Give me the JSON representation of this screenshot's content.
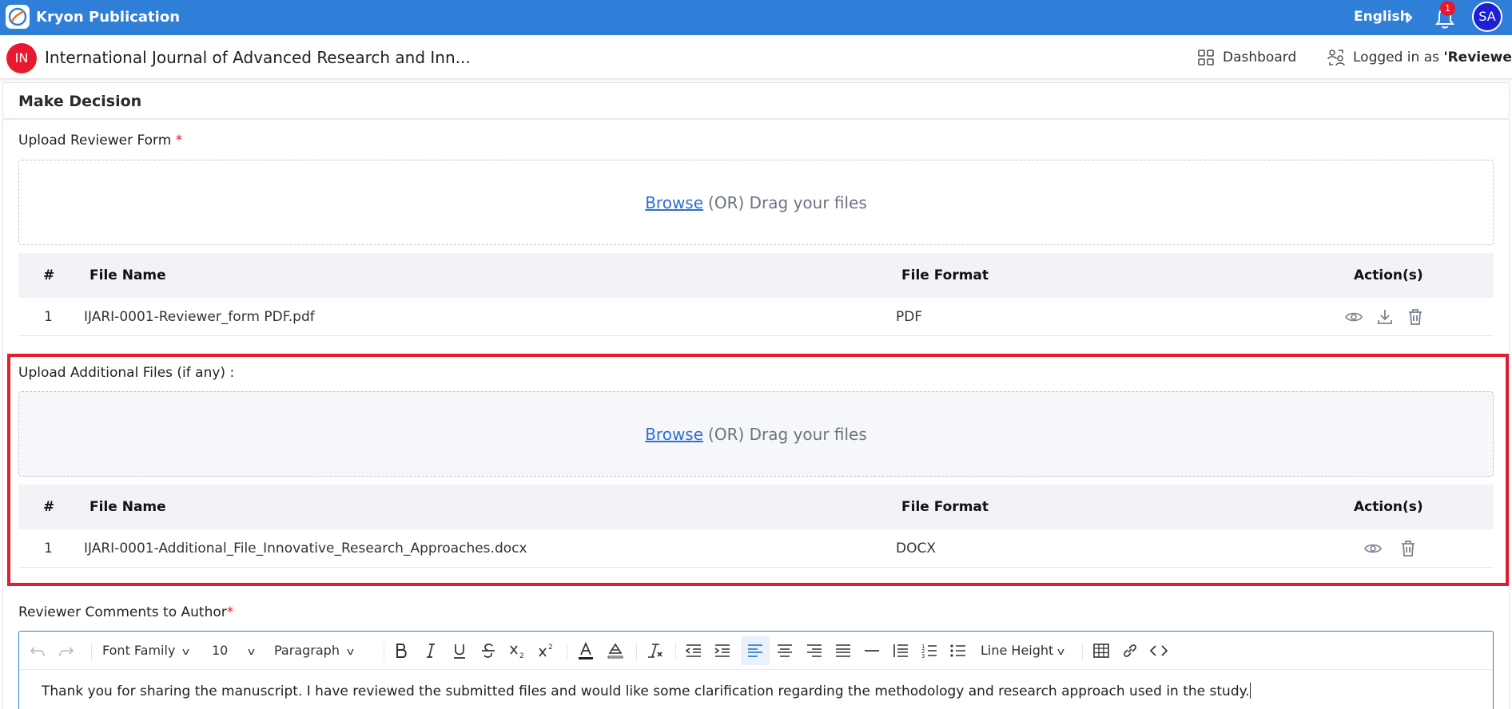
{
  "topbar": {
    "brand_name": "Kryon Publication",
    "language": "English",
    "notification_count": "1",
    "user_initials": "SA",
    "bar_color": "#2f7ed8"
  },
  "journal": {
    "initials": "IN",
    "title": "International Journal of Advanced Research and Inn...",
    "dashboard_label": "Dashboard",
    "logged_in_prefix": "Logged in as ",
    "role": "'Reviewer'"
  },
  "card": {
    "title": "Make Decision"
  },
  "reviewer_form": {
    "label": "Upload Reviewer Form",
    "required_mark": "*",
    "browse": "Browse",
    "drag_text": "(OR) Drag your files",
    "columns": {
      "num": "#",
      "name": "File Name",
      "format": "File Format",
      "actions": "Action(s)"
    },
    "rows": [
      {
        "num": "1",
        "name": "IJARI-0001-Reviewer_form PDF.pdf",
        "format": "PDF",
        "actions": [
          "view-icon",
          "download-icon",
          "delete-icon"
        ]
      }
    ]
  },
  "additional_files": {
    "label": "Upload Additional Files (if any) :",
    "browse": "Browse",
    "drag_text": "(OR) Drag your files",
    "columns": {
      "num": "#",
      "name": "File Name",
      "format": "File Format",
      "actions": "Action(s)"
    },
    "rows": [
      {
        "num": "1",
        "name": "IJARI-0001-Additional_File_Innovative_Research_Approaches.docx",
        "format": "DOCX",
        "actions": [
          "view-icon",
          "delete-icon"
        ]
      }
    ],
    "highlight_color": "#e01e2d"
  },
  "comments": {
    "label": "Reviewer Comments to Author",
    "required_mark": "*",
    "toolbar": {
      "font_family": "Font Family",
      "font_size": "10",
      "block_format": "Paragraph",
      "line_height": "Line Height",
      "active_alignment": "align-left"
    },
    "text": "Thank you for sharing the manuscript. I have reviewed the submitted files and would like some clarification regarding the methodology and research approach used in the study."
  }
}
